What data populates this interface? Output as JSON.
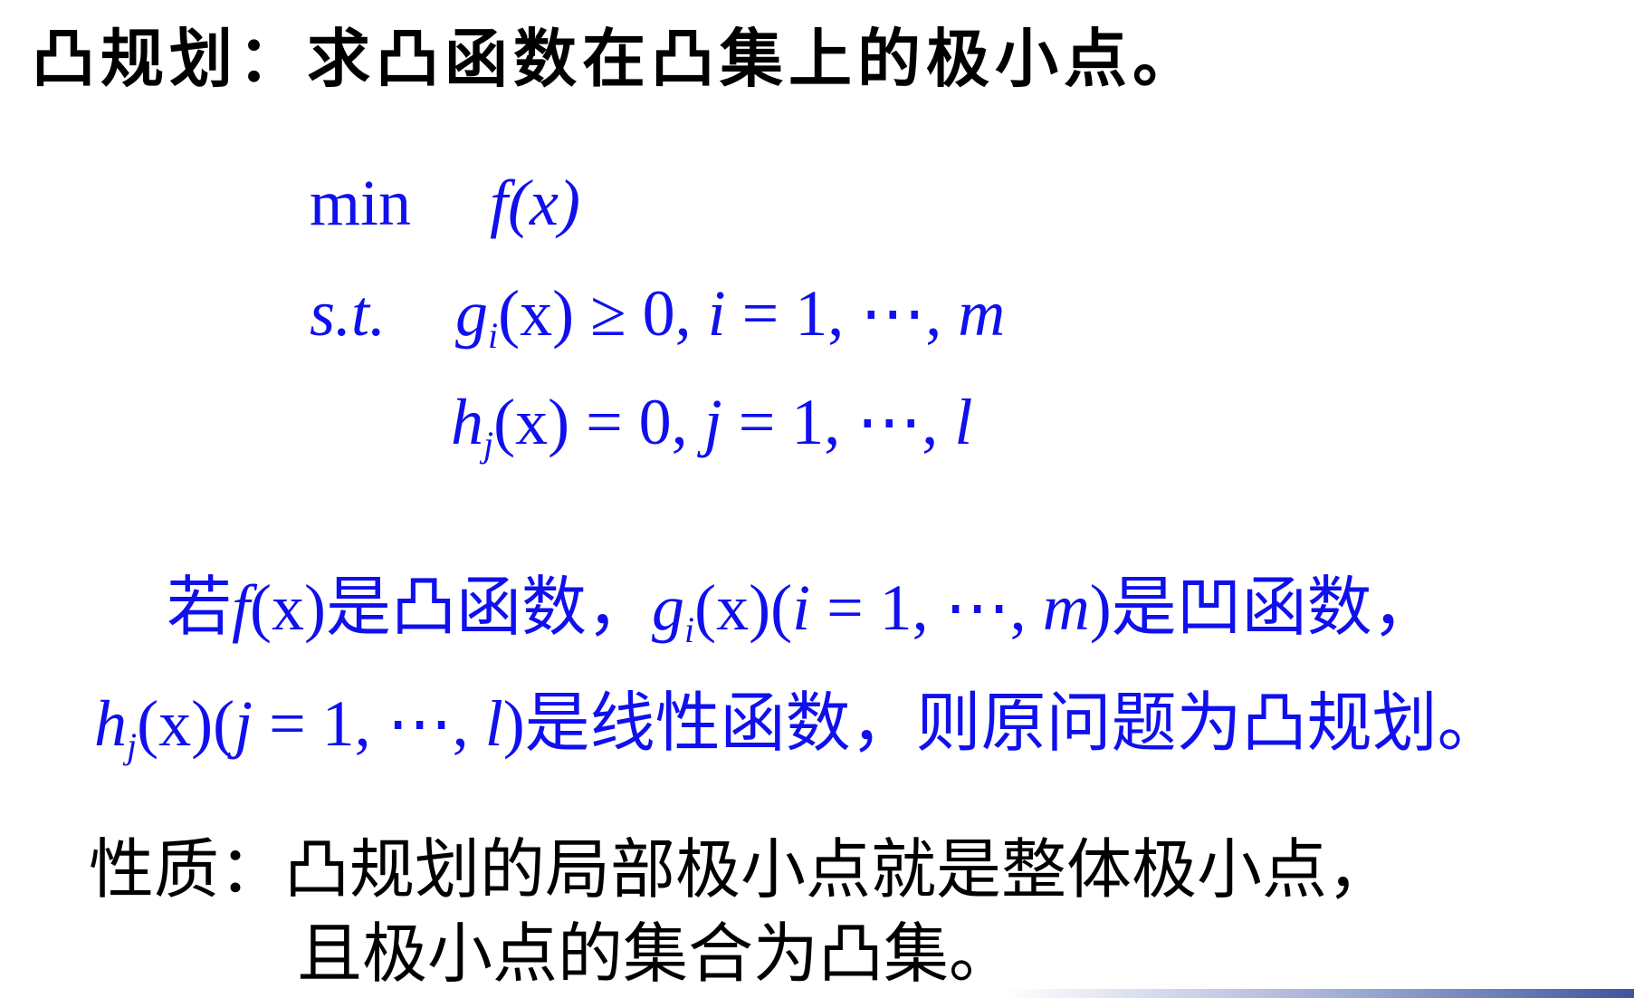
{
  "title": "凸规划：求凸函数在凸集上的极小点。",
  "problem": {
    "objective_keyword": "min",
    "objective": "f(x)",
    "constraint_keyword": "s.t.",
    "inequality": {
      "func": "g",
      "sub": "i",
      "rest": "(x) ≥ 0, ",
      "index": "i",
      "range": " = 1, ⋯, ",
      "end": "m"
    },
    "equality": {
      "func": "h",
      "sub": "j",
      "rest": "(x) = 0, ",
      "index": "j",
      "range": " = 1, ⋯, ",
      "end": "l"
    }
  },
  "condition": {
    "line1_a": "若",
    "line1_f": "f",
    "line1_b": "(x)是凸函数，",
    "line1_g": "g",
    "line1_gsub": "i",
    "line1_c": "(x)(",
    "line1_i": "i",
    "line1_d": " = 1, ⋯, ",
    "line1_m": "m",
    "line1_e": ")是凹函数，",
    "line2_h": "h",
    "line2_hsub": "j",
    "line2_a": "(x)(",
    "line2_j": "j",
    "line2_b": " = 1, ⋯, ",
    "line2_l": "l",
    "line2_c": ")是线性函数，则原问题为凸规划。"
  },
  "property": {
    "label": "性质：",
    "line1": "凸规划的局部极小点就是整体极小点，",
    "line2": "且极小点的集合为凸集。"
  },
  "colors": {
    "math": "#1010ee",
    "text": "#000000",
    "footer_bar": "#3e56a0"
  }
}
